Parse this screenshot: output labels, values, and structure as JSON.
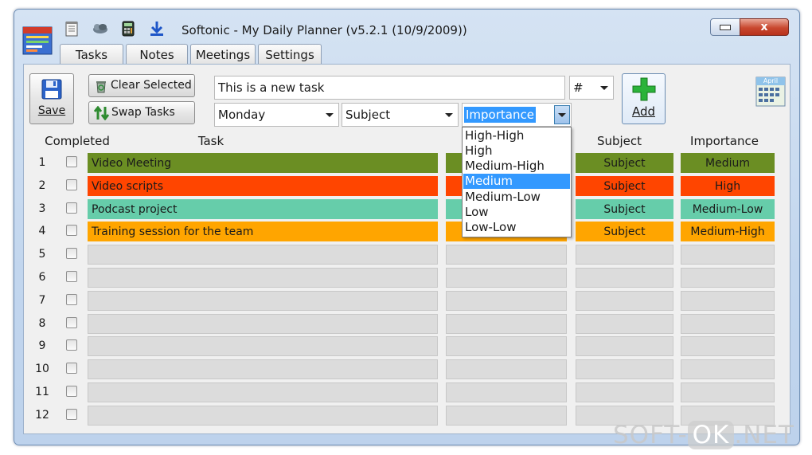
{
  "window": {
    "title": "Softonic - My Daily Planner (v5.2.1 (10/9/2009))",
    "close_glyph": "x",
    "min_glyph": "▭"
  },
  "toolbar_icons": [
    "notepad-icon",
    "cloud-icon",
    "calculator-icon",
    "download-icon"
  ],
  "tabs": [
    {
      "label": "Tasks"
    },
    {
      "label": "Notes"
    },
    {
      "label": "Meetings"
    },
    {
      "label": "Settings"
    }
  ],
  "actions": {
    "save_label": "Save",
    "clear_selected_label": "Clear Selected",
    "swap_tasks_label": "Swap Tasks",
    "add_label": "Add",
    "calendar_label": "April"
  },
  "form": {
    "task_text": "This is a new task",
    "number_value": "#",
    "day_value": "Monday",
    "subject_value": "Subject",
    "importance_value": "Importance"
  },
  "importance_dropdown": {
    "options": [
      "High-High",
      "High",
      "Medium-High",
      "Medium",
      "Medium-Low",
      "Low",
      "Low-Low"
    ],
    "selected": "Medium"
  },
  "table": {
    "headers": {
      "completed": "Completed",
      "task": "Task",
      "subject": "Subject",
      "importance": "Importance"
    },
    "rows": [
      {
        "num": "1",
        "task": "Video Meeting",
        "subject": "Subject",
        "importance": "Medium",
        "color": "#6b8e23"
      },
      {
        "num": "2",
        "task": "Video scripts",
        "subject": "Subject",
        "importance": "High",
        "color": "#ff4500"
      },
      {
        "num": "3",
        "task": "Podcast project",
        "subject": "Subject",
        "importance": "Medium-Low",
        "color": "#66cdaa"
      },
      {
        "num": "4",
        "task": "Training session for the team",
        "subject": "Subject",
        "importance": "Medium-High",
        "color": "#ffa500"
      },
      {
        "num": "5",
        "task": "",
        "subject": "",
        "importance": "",
        "color": ""
      },
      {
        "num": "6",
        "task": "",
        "subject": "",
        "importance": "",
        "color": ""
      },
      {
        "num": "7",
        "task": "",
        "subject": "",
        "importance": "",
        "color": ""
      },
      {
        "num": "8",
        "task": "",
        "subject": "",
        "importance": "",
        "color": ""
      },
      {
        "num": "9",
        "task": "",
        "subject": "",
        "importance": "",
        "color": ""
      },
      {
        "num": "10",
        "task": "",
        "subject": "",
        "importance": "",
        "color": ""
      },
      {
        "num": "11",
        "task": "",
        "subject": "",
        "importance": "",
        "color": ""
      },
      {
        "num": "12",
        "task": "",
        "subject": "",
        "importance": "",
        "color": ""
      }
    ]
  },
  "watermark": {
    "left": "SOFT-",
    "ok": "OK",
    "right": ".NET"
  }
}
